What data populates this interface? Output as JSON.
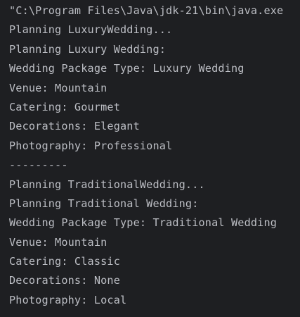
{
  "console": {
    "lines": [
      "\"C:\\Program Files\\Java\\jdk-21\\bin\\java.exe",
      "Planning LuxuryWedding...",
      "Planning Luxury Wedding:",
      "Wedding Package Type: Luxury Wedding",
      "Venue: Mountain",
      "Catering: Gourmet",
      "Decorations: Elegant",
      "Photography: Professional",
      "---------",
      "Planning TraditionalWedding...",
      "Planning Traditional Wedding:",
      "Wedding Package Type: Traditional Wedding",
      "Venue: Mountain",
      "Catering: Classic",
      "Decorations: None",
      "Photography: Local"
    ]
  },
  "colors": {
    "background": "#1e1f22",
    "text": "#bcbec4"
  }
}
